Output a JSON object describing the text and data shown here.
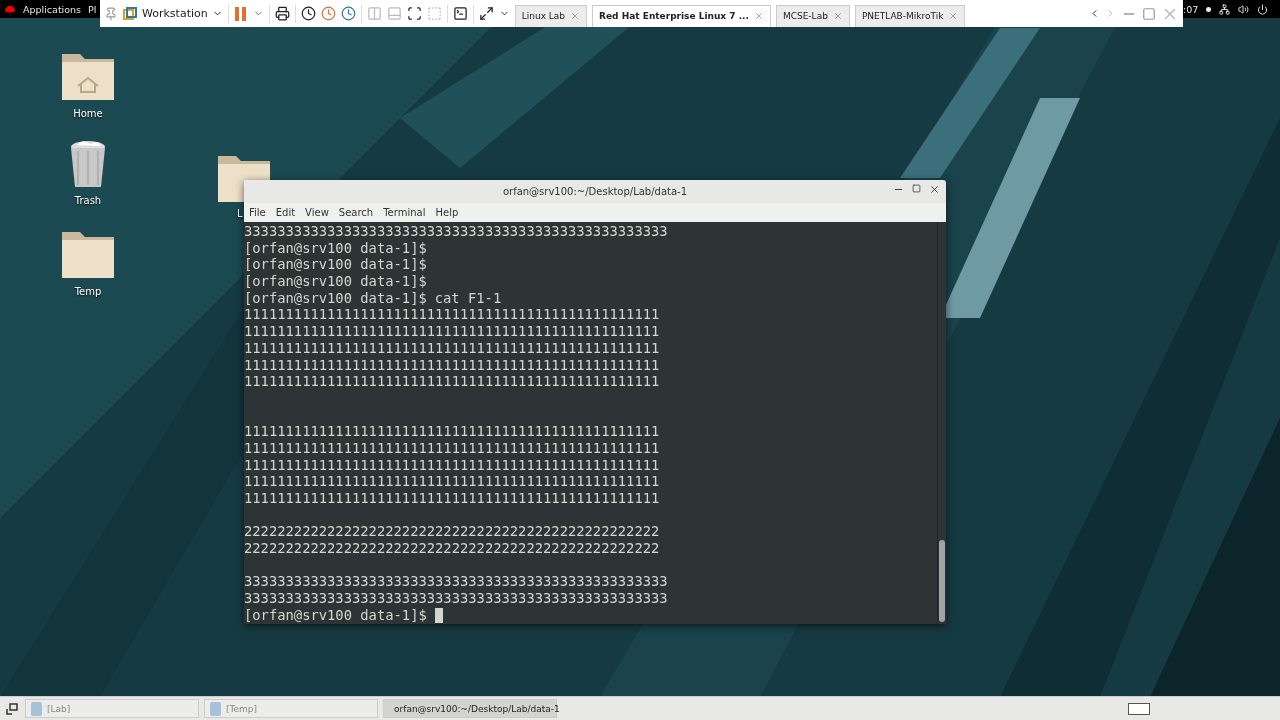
{
  "top_bar": {
    "applications": "Applications",
    "places": "Pl",
    "clock": ":07"
  },
  "vm_toolbar": {
    "vm_menu": "Workstation",
    "tabs": [
      {
        "label": "Linux Lab",
        "selected": false
      },
      {
        "label": "Red Hat Enterprise Linux 7 ...",
        "selected": true
      },
      {
        "label": "MCSE-Lab",
        "selected": false
      },
      {
        "label": "PNETLAB-MikroTik",
        "selected": false
      }
    ]
  },
  "desktop_icons": [
    {
      "kind": "home",
      "label": "Home"
    },
    {
      "kind": "trash",
      "label": "Trash"
    },
    {
      "kind": "folder",
      "label": "Temp"
    }
  ],
  "covered_folder": {
    "label": "L"
  },
  "terminal": {
    "title": "orfan@srv100:~/Desktop/Lab/data-1",
    "menu": [
      "File",
      "Edit",
      "View",
      "Search",
      "Terminal",
      "Help"
    ],
    "lines": [
      {
        "kind": "output",
        "text": "333333333333333333333333333333333333333333333333333"
      },
      {
        "kind": "prompt",
        "text": "[orfan@srv100 data-1]$",
        "cursor": false
      },
      {
        "kind": "prompt",
        "text": "[orfan@srv100 data-1]$",
        "cursor": false
      },
      {
        "kind": "prompt",
        "text": "[orfan@srv100 data-1]$",
        "cursor": false
      },
      {
        "kind": "prompt",
        "text": "[orfan@srv100 data-1]$",
        "command": "cat F1-1",
        "cursor": false
      },
      {
        "kind": "output",
        "text": "11111111111111111111111111111111111111111111111111"
      },
      {
        "kind": "output",
        "text": "11111111111111111111111111111111111111111111111111"
      },
      {
        "kind": "output",
        "text": "11111111111111111111111111111111111111111111111111"
      },
      {
        "kind": "output",
        "text": "11111111111111111111111111111111111111111111111111"
      },
      {
        "kind": "output",
        "text": "11111111111111111111111111111111111111111111111111"
      },
      {
        "kind": "blank"
      },
      {
        "kind": "blank"
      },
      {
        "kind": "output",
        "text": "11111111111111111111111111111111111111111111111111"
      },
      {
        "kind": "output",
        "text": "11111111111111111111111111111111111111111111111111"
      },
      {
        "kind": "output",
        "text": "11111111111111111111111111111111111111111111111111"
      },
      {
        "kind": "output",
        "text": "11111111111111111111111111111111111111111111111111"
      },
      {
        "kind": "output",
        "text": "11111111111111111111111111111111111111111111111111"
      },
      {
        "kind": "blank"
      },
      {
        "kind": "output",
        "text": "22222222222222222222222222222222222222222222222222"
      },
      {
        "kind": "output",
        "text": "22222222222222222222222222222222222222222222222222"
      },
      {
        "kind": "blank"
      },
      {
        "kind": "output",
        "text": "333333333333333333333333333333333333333333333333333"
      },
      {
        "kind": "output",
        "text": "333333333333333333333333333333333333333333333333333"
      },
      {
        "kind": "prompt",
        "text": "[orfan@srv100 data-1]$",
        "cursor": true
      }
    ]
  },
  "taskbar": {
    "items": [
      {
        "kind": "folder",
        "label": "[Lab]",
        "selected": false
      },
      {
        "kind": "folder",
        "label": "[Temp]",
        "selected": false
      },
      {
        "kind": "terminal",
        "label": "orfan@srv100:~/Desktop/Lab/data-1",
        "selected": true
      }
    ]
  }
}
